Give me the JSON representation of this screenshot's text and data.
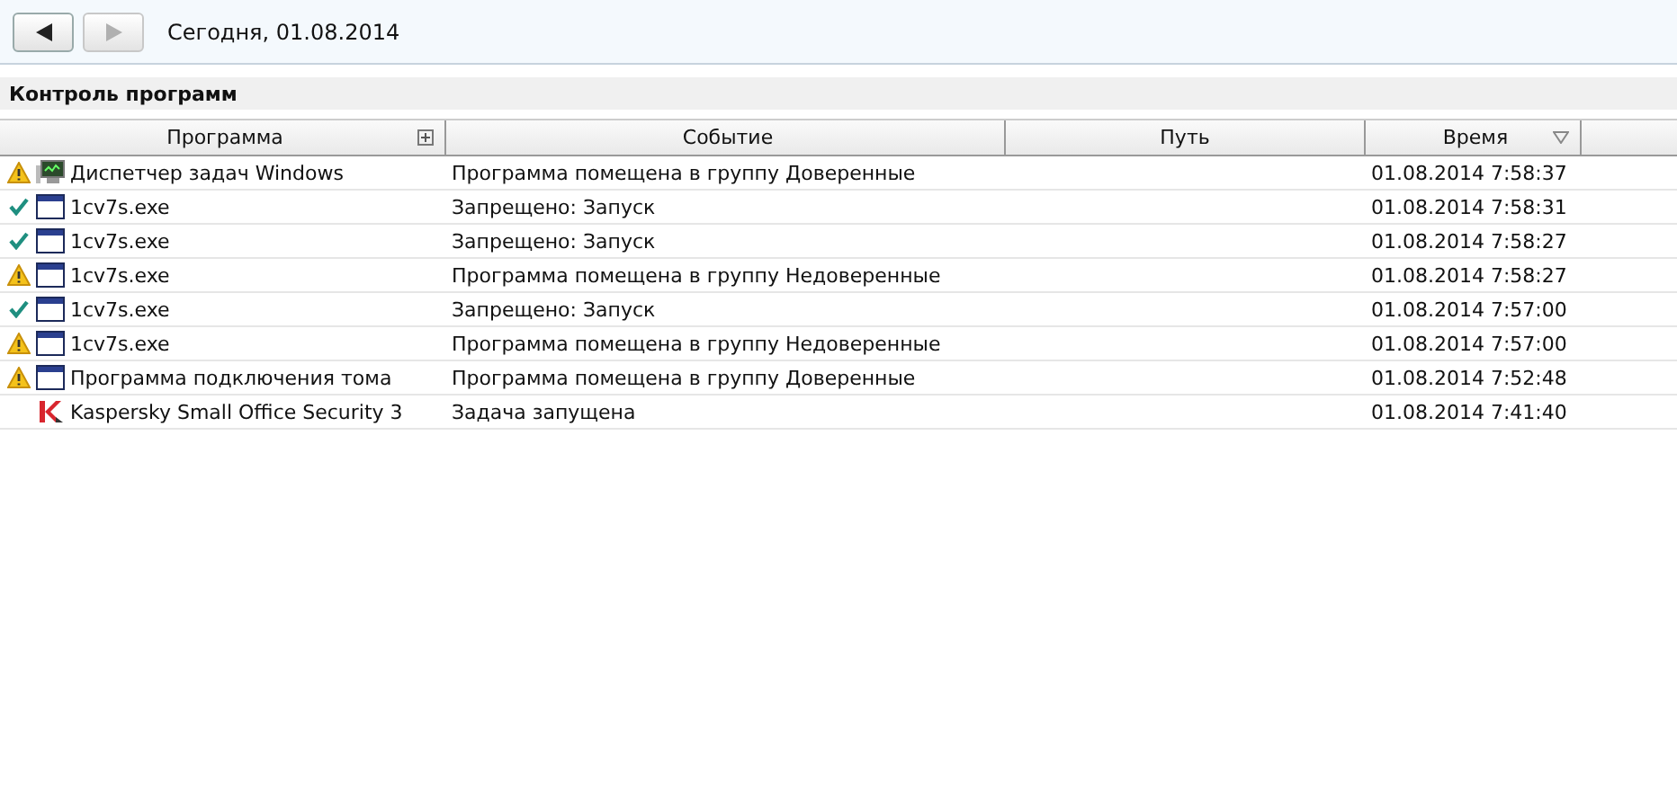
{
  "toolbar": {
    "back_disabled": false,
    "forward_disabled": true,
    "date": "Сегодня, 01.08.2014"
  },
  "section": {
    "title": "Контроль программ"
  },
  "table": {
    "columns": [
      {
        "label": "Программа",
        "expander": true,
        "sorted": false
      },
      {
        "label": "Событие",
        "expander": false,
        "sorted": false
      },
      {
        "label": "Путь",
        "expander": false,
        "sorted": false
      },
      {
        "label": "Время",
        "expander": false,
        "sorted": true
      }
    ],
    "rows": [
      {
        "status": {
          "kind": "warning"
        },
        "app_icon": {
          "kind": "monitor"
        },
        "program": "Диспетчер задач Windows",
        "event": "Программа помещена в группу Доверенные",
        "time": "01.08.2014 7:58:37"
      },
      {
        "status": {
          "kind": "allowed"
        },
        "app_icon": {
          "kind": "window"
        },
        "program": "1cv7s.exe",
        "event": "Запрещено: Запуск",
        "time": "01.08.2014 7:58:31"
      },
      {
        "status": {
          "kind": "allowed"
        },
        "app_icon": {
          "kind": "window"
        },
        "program": "1cv7s.exe",
        "event": "Запрещено: Запуск",
        "time": "01.08.2014 7:58:27"
      },
      {
        "status": {
          "kind": "warning"
        },
        "app_icon": {
          "kind": "window"
        },
        "program": "1cv7s.exe",
        "event": "Программа помещена в группу Недоверенные",
        "time": "01.08.2014 7:58:27"
      },
      {
        "status": {
          "kind": "allowed"
        },
        "app_icon": {
          "kind": "window"
        },
        "program": "1cv7s.exe",
        "event": "Запрещено: Запуск",
        "time": "01.08.2014 7:57:00"
      },
      {
        "status": {
          "kind": "warning"
        },
        "app_icon": {
          "kind": "window"
        },
        "program": "1cv7s.exe",
        "event": "Программа помещена в группу Недоверенные",
        "time": "01.08.2014 7:57:00"
      },
      {
        "status": {
          "kind": "warning"
        },
        "app_icon": {
          "kind": "window"
        },
        "program": "Программа подключения тома",
        "event": "Программа помещена в группу Доверенные",
        "time": "01.08.2014 7:52:48"
      },
      {
        "app_icon": {
          "kind": "k-logo"
        },
        "program": "Kaspersky Small Office Security 3",
        "event": "Задача запущена",
        "time": "01.08.2014 7:41:40"
      }
    ]
  }
}
